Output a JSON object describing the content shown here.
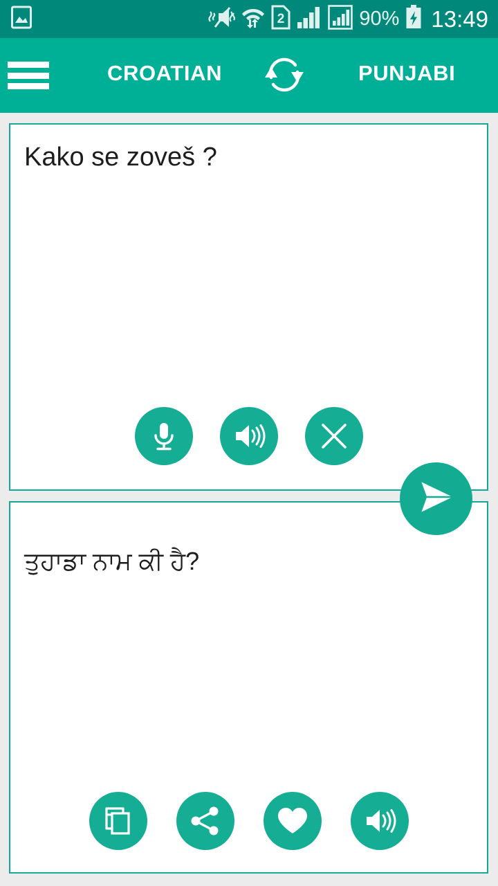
{
  "statusbar": {
    "battery_percent": "90%",
    "clock": "13:49",
    "icons": [
      "gallery-image-icon",
      "vibrate-mute-icon",
      "wifi-data-transfer-icon",
      "sim-2-icon",
      "signal-bars-icon",
      "signal-bars-boxed-icon",
      "battery-charging-icon"
    ],
    "sim_label": "2"
  },
  "appbar": {
    "menu_icon": "hamburger-menu-icon",
    "source_language": "CROATIAN",
    "target_language": "PUNJABI",
    "swap_icon": "swap-languages-icon"
  },
  "source_card": {
    "text": "Kako se zoveš ?",
    "buttons": [
      {
        "name": "microphone-button",
        "icon": "microphone-icon"
      },
      {
        "name": "speak-source-button",
        "icon": "speaker-icon"
      },
      {
        "name": "clear-text-button",
        "icon": "close-icon"
      }
    ]
  },
  "target_card": {
    "text": "ਤੁਹਾਡਾ ਨਾਮ ਕੀ ਹੈ?",
    "buttons": [
      {
        "name": "copy-button",
        "icon": "copy-icon"
      },
      {
        "name": "share-button",
        "icon": "share-icon"
      },
      {
        "name": "favorite-button",
        "icon": "heart-icon"
      },
      {
        "name": "speak-target-button",
        "icon": "speaker-icon"
      }
    ]
  },
  "fab": {
    "name": "translate-send-button",
    "icon": "send-paper-plane-icon"
  },
  "colors": {
    "statusbar": "#00897a",
    "appbar": "#00b096",
    "accent": "#15ad94",
    "card_border": "#14a996",
    "page_background": "#ececec",
    "text": "#1d1d1d"
  }
}
